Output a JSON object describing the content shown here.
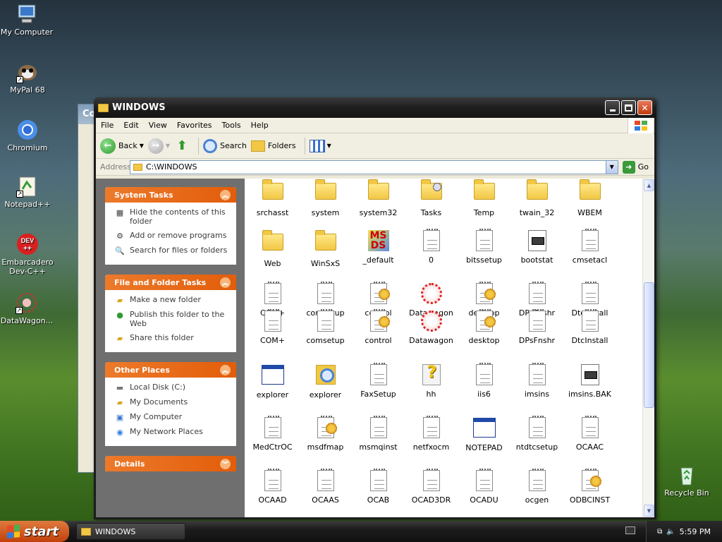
{
  "desktop": {
    "icons": [
      {
        "label": "My Computer"
      },
      {
        "label": "MyPal 68"
      },
      {
        "label": "Chromium"
      },
      {
        "label": "Notepad++"
      },
      {
        "label": "Embarcadero Dev-C++"
      },
      {
        "label": "DataWagon..."
      },
      {
        "label": "Recycle Bin"
      }
    ],
    "bg_window_title": "Co"
  },
  "window": {
    "title": "WINDOWS",
    "menu": [
      "File",
      "Edit",
      "View",
      "Favorites",
      "Tools",
      "Help"
    ],
    "toolbar": {
      "back": "Back",
      "search": "Search",
      "folders": "Folders"
    },
    "address": {
      "label": "Address",
      "value": "C:\\WINDOWS",
      "go": "Go"
    },
    "panels": {
      "system_tasks": {
        "title": "System Tasks",
        "items": [
          "Hide the contents of this folder",
          "Add or remove programs",
          "Search for files or folders"
        ]
      },
      "file_tasks": {
        "title": "File and Folder Tasks",
        "items": [
          "Make a new folder",
          "Publish this folder to the Web",
          "Share this folder"
        ]
      },
      "other_places": {
        "title": "Other Places",
        "items": [
          "Local Disk (C:)",
          "My Documents",
          "My Computer",
          "My Network Places"
        ]
      },
      "details": {
        "title": "Details"
      }
    },
    "files": [
      [
        "srchasst",
        "system",
        "system32",
        "Tasks",
        "Temp",
        "twain_32",
        "WBEM"
      ],
      [
        "Web",
        "WinSxS",
        "_default",
        "0",
        "bitssetup",
        "bootstat",
        "cmsetacl"
      ],
      [
        "COM+",
        "comsetup",
        "control",
        "Datawagon",
        "desktop",
        "DPsFnshr",
        "DtcInstall"
      ],
      [
        "COM+",
        "comsetup",
        "control",
        "Datawagon",
        "desktop",
        "DPsFnshr",
        "DtcInstall"
      ],
      [
        "explorer",
        "explorer",
        "FaxSetup",
        "hh",
        "iis6",
        "imsins",
        "imsins.BAK"
      ],
      [
        "MedCtrOC",
        "msdfmap",
        "msmqinst",
        "netfxocm",
        "NOTEPAD",
        "ntdtcsetup",
        "OCAAC"
      ],
      [
        "OCAAD",
        "OCAAS",
        "OCAB",
        "OCAD3DR",
        "OCADU",
        "ocgen",
        "ODBCINST"
      ]
    ]
  },
  "taskbar": {
    "start": "start",
    "task": "WINDOWS",
    "clock": "5:59 PM"
  }
}
